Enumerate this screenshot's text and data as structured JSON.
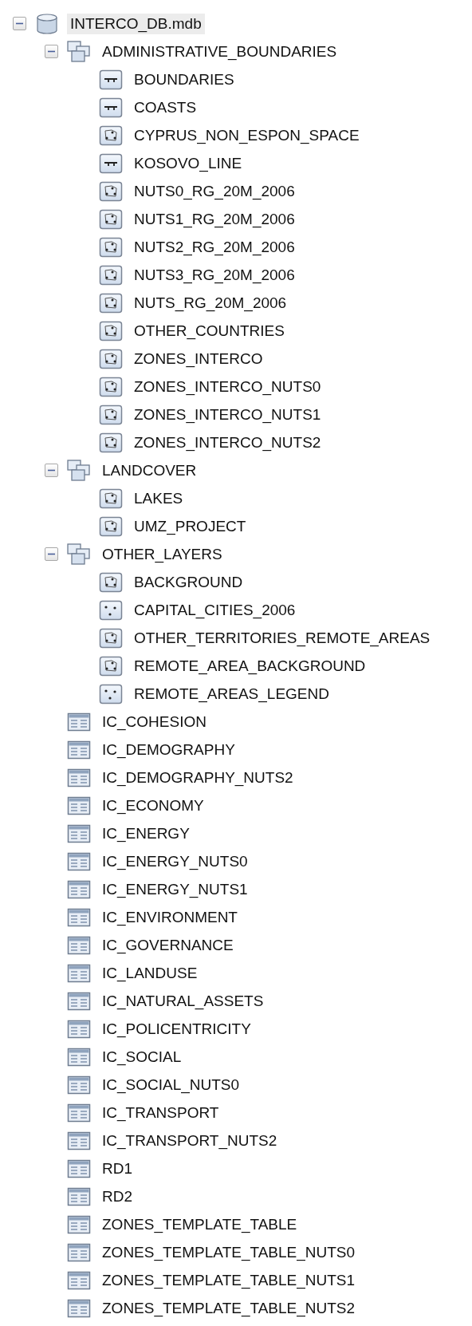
{
  "tree": [
    {
      "name": "INTERCO_DB.mdb",
      "kind": "database",
      "expanded": true,
      "selected": true,
      "children": [
        {
          "name": "ADMINISTRATIVE_BOUNDARIES",
          "kind": "dataset",
          "expanded": true,
          "selected": false,
          "children": [
            {
              "name": "BOUNDARIES",
              "kind": "line",
              "selected": false
            },
            {
              "name": "COASTS",
              "kind": "line",
              "selected": false
            },
            {
              "name": "CYPRUS_NON_ESPON_SPACE",
              "kind": "polygon",
              "selected": false
            },
            {
              "name": "KOSOVO_LINE",
              "kind": "line",
              "selected": false
            },
            {
              "name": "NUTS0_RG_20M_2006",
              "kind": "polygon",
              "selected": false
            },
            {
              "name": "NUTS1_RG_20M_2006",
              "kind": "polygon",
              "selected": false
            },
            {
              "name": "NUTS2_RG_20M_2006",
              "kind": "polygon",
              "selected": false
            },
            {
              "name": "NUTS3_RG_20M_2006",
              "kind": "polygon",
              "selected": false
            },
            {
              "name": "NUTS_RG_20M_2006",
              "kind": "polygon",
              "selected": false
            },
            {
              "name": "OTHER_COUNTRIES",
              "kind": "polygon",
              "selected": false
            },
            {
              "name": "ZONES_INTERCO",
              "kind": "polygon",
              "selected": false
            },
            {
              "name": "ZONES_INTERCO_NUTS0",
              "kind": "polygon",
              "selected": false
            },
            {
              "name": "ZONES_INTERCO_NUTS1",
              "kind": "polygon",
              "selected": false
            },
            {
              "name": "ZONES_INTERCO_NUTS2",
              "kind": "polygon",
              "selected": false
            }
          ]
        },
        {
          "name": "LANDCOVER",
          "kind": "dataset",
          "expanded": true,
          "selected": false,
          "children": [
            {
              "name": "LAKES",
              "kind": "polygon",
              "selected": false
            },
            {
              "name": "UMZ_PROJECT",
              "kind": "polygon",
              "selected": false
            }
          ]
        },
        {
          "name": "OTHER_LAYERS",
          "kind": "dataset",
          "expanded": true,
          "selected": false,
          "children": [
            {
              "name": "BACKGROUND",
              "kind": "polygon",
              "selected": false
            },
            {
              "name": "CAPITAL_CITIES_2006",
              "kind": "point",
              "selected": false
            },
            {
              "name": "OTHER_TERRITORIES_REMOTE_AREAS",
              "kind": "polygon",
              "selected": false
            },
            {
              "name": "REMOTE_AREA_BACKGROUND",
              "kind": "polygon",
              "selected": false
            },
            {
              "name": "REMOTE_AREAS_LEGEND",
              "kind": "point",
              "selected": false
            }
          ]
        },
        {
          "name": "IC_COHESION",
          "kind": "table",
          "selected": false
        },
        {
          "name": "IC_DEMOGRAPHY",
          "kind": "table",
          "selected": false
        },
        {
          "name": "IC_DEMOGRAPHY_NUTS2",
          "kind": "table",
          "selected": false
        },
        {
          "name": "IC_ECONOMY",
          "kind": "table",
          "selected": false
        },
        {
          "name": "IC_ENERGY",
          "kind": "table",
          "selected": false
        },
        {
          "name": "IC_ENERGY_NUTS0",
          "kind": "table",
          "selected": false
        },
        {
          "name": "IC_ENERGY_NUTS1",
          "kind": "table",
          "selected": false
        },
        {
          "name": "IC_ENVIRONMENT",
          "kind": "table",
          "selected": false
        },
        {
          "name": "IC_GOVERNANCE",
          "kind": "table",
          "selected": false
        },
        {
          "name": "IC_LANDUSE",
          "kind": "table",
          "selected": false
        },
        {
          "name": "IC_NATURAL_ASSETS",
          "kind": "table",
          "selected": false
        },
        {
          "name": "IC_POLICENTRICITY",
          "kind": "table",
          "selected": false
        },
        {
          "name": "IC_SOCIAL",
          "kind": "table",
          "selected": false
        },
        {
          "name": "IC_SOCIAL_NUTS0",
          "kind": "table",
          "selected": false
        },
        {
          "name": "IC_TRANSPORT",
          "kind": "table",
          "selected": false
        },
        {
          "name": "IC_TRANSPORT_NUTS2",
          "kind": "table",
          "selected": false
        },
        {
          "name": "RD1",
          "kind": "table",
          "selected": false
        },
        {
          "name": "RD2",
          "kind": "table",
          "selected": false
        },
        {
          "name": "ZONES_TEMPLATE_TABLE",
          "kind": "table",
          "selected": false
        },
        {
          "name": "ZONES_TEMPLATE_TABLE_NUTS0",
          "kind": "table",
          "selected": false
        },
        {
          "name": "ZONES_TEMPLATE_TABLE_NUTS1",
          "kind": "table",
          "selected": false
        },
        {
          "name": "ZONES_TEMPLATE_TABLE_NUTS2",
          "kind": "table",
          "selected": false
        }
      ]
    }
  ]
}
